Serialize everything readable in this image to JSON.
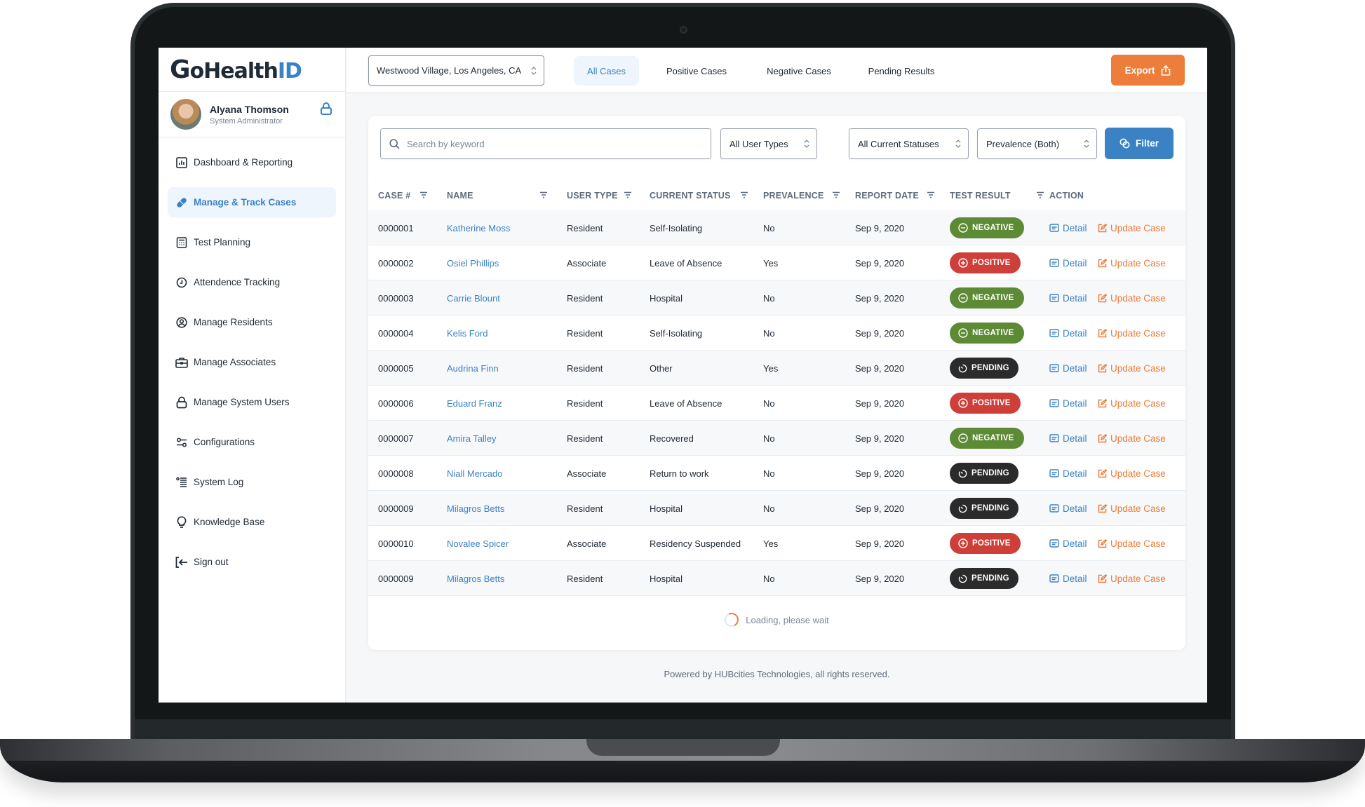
{
  "app": {
    "logo_prefix": "G",
    "logo_mid": "oHealth",
    "logo_suffix": "ID",
    "brand_colors": {
      "primary": "#3b82c4",
      "accent": "#ec7d3a",
      "dark": "#1f2a37"
    }
  },
  "user": {
    "name": "Alyana Thomson",
    "role": "System Administrator",
    "lock_icon": "lock-icon"
  },
  "sidebar": {
    "items": [
      {
        "label": "Dashboard & Reporting",
        "icon": "bar-chart-icon",
        "active": false
      },
      {
        "label": "Manage & Track Cases",
        "icon": "pill-icon",
        "active": true
      },
      {
        "label": "Test Planning",
        "icon": "calculator-icon",
        "active": false
      },
      {
        "label": "Attendence Tracking",
        "icon": "clock-icon",
        "active": false
      },
      {
        "label": "Manage Residents",
        "icon": "user-circle-icon",
        "active": false
      },
      {
        "label": "Manage Associates",
        "icon": "briefcase-icon",
        "active": false
      },
      {
        "label": "Manage System Users",
        "icon": "lock-icon",
        "active": false
      },
      {
        "label": "Configurations",
        "icon": "sliders-icon",
        "active": false
      },
      {
        "label": "System Log",
        "icon": "list-icon",
        "active": false
      },
      {
        "label": "Knowledge Base",
        "icon": "lightbulb-icon",
        "active": false
      },
      {
        "label": "Sign out",
        "icon": "sign-out-icon",
        "active": false
      }
    ]
  },
  "topbar": {
    "location": "Westwood Village, Los Angeles, CA",
    "tabs": [
      {
        "label": "All Cases",
        "active": true
      },
      {
        "label": "Positive Cases",
        "active": false
      },
      {
        "label": "Negative Cases",
        "active": false
      },
      {
        "label": "Pending Results",
        "active": false
      }
    ],
    "export_label": "Export"
  },
  "filters": {
    "search_placeholder": "Search by keyword",
    "search_value": "",
    "user_type": "All User Types",
    "status": "All Current Statuses",
    "prevalence": "Prevalence (Both)",
    "filter_label": "Filter"
  },
  "table": {
    "columns": [
      "CASE #",
      "NAME",
      "USER TYPE",
      "CURRENT STATUS",
      "PREVALENCE",
      "REPORT DATE",
      "TEST RESULT",
      "ACTION"
    ],
    "rows": [
      {
        "case": "0000001",
        "name": "Katherine Moss",
        "user_type": "Resident",
        "status": "Self-Isolating",
        "prevalence": "No",
        "date": "Sep 9, 2020",
        "result": "NEGATIVE"
      },
      {
        "case": "0000002",
        "name": "Osiel Phillips",
        "user_type": "Associate",
        "status": "Leave of Absence",
        "prevalence": "Yes",
        "date": "Sep 9, 2020",
        "result": "POSITIVE"
      },
      {
        "case": "0000003",
        "name": "Carrie Blount",
        "user_type": "Resident",
        "status": "Hospital",
        "prevalence": "No",
        "date": "Sep 9, 2020",
        "result": "NEGATIVE"
      },
      {
        "case": "0000004",
        "name": "Kelis Ford",
        "user_type": "Resident",
        "status": "Self-Isolating",
        "prevalence": "No",
        "date": "Sep 9, 2020",
        "result": "NEGATIVE"
      },
      {
        "case": "0000005",
        "name": "Audrina Finn",
        "user_type": "Resident",
        "status": "Other",
        "prevalence": "Yes",
        "date": "Sep 9, 2020",
        "result": "PENDING"
      },
      {
        "case": "0000006",
        "name": "Eduard Franz",
        "user_type": "Resident",
        "status": "Leave of Absence",
        "prevalence": "No",
        "date": "Sep 9, 2020",
        "result": "POSITIVE"
      },
      {
        "case": "0000007",
        "name": "Amira Talley",
        "user_type": "Resident",
        "status": "Recovered",
        "prevalence": "No",
        "date": "Sep 9, 2020",
        "result": "NEGATIVE"
      },
      {
        "case": "0000008",
        "name": "Niall Mercado",
        "user_type": "Associate",
        "status": "Return to work",
        "prevalence": "No",
        "date": "Sep 9, 2020",
        "result": "PENDING"
      },
      {
        "case": "0000009",
        "name": "Milagros Betts",
        "user_type": "Resident",
        "status": "Hospital",
        "prevalence": "No",
        "date": "Sep 9, 2020",
        "result": "PENDING"
      },
      {
        "case": "0000010",
        "name": "Novalee Spicer",
        "user_type": "Associate",
        "status": "Residency Suspended",
        "prevalence": "Yes",
        "date": "Sep 9, 2020",
        "result": "POSITIVE"
      },
      {
        "case": "0000009",
        "name": "Milagros Betts",
        "user_type": "Resident",
        "status": "Hospital",
        "prevalence": "No",
        "date": "Sep 9, 2020",
        "result": "PENDING"
      }
    ],
    "actions": {
      "detail": "Detail",
      "update": "Update Case"
    },
    "result_colors": {
      "NEGATIVE": "#5d8a34",
      "POSITIVE": "#cf3f3a",
      "PENDING": "#2b2b2b"
    }
  },
  "loading_text": "Loading, please wait",
  "footer_text": "Powered by HUBcities Technologies, all rights reserved."
}
